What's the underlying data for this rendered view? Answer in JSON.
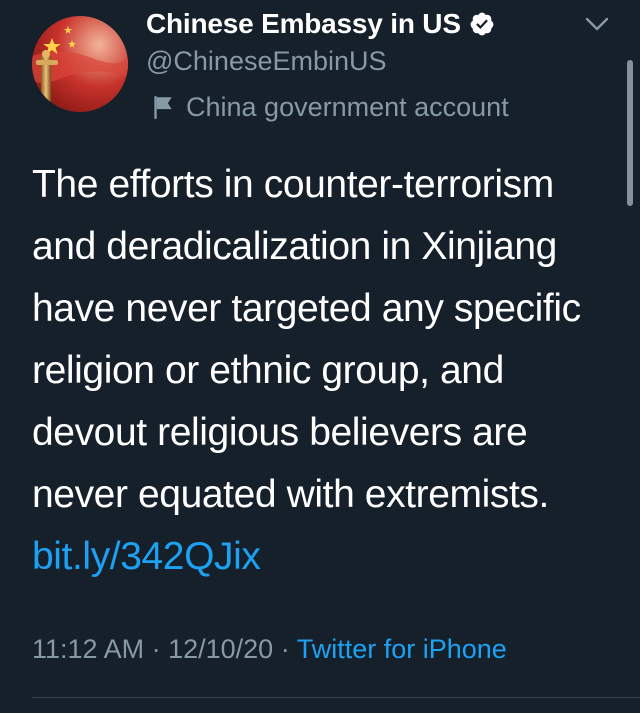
{
  "account": {
    "display_name": "Chinese Embassy in US",
    "handle": "@ChineseEmbinUS",
    "label": "China government account",
    "verified": true,
    "verified_icon": "verified-badge-icon",
    "label_icon": "flag-icon",
    "menu_icon": "chevron-down-icon"
  },
  "tweet": {
    "text": "The efforts in counter-terrorism and deradicalization in Xinjiang have never targeted any specific religion or ethnic group, and devout religious believers are never equated with extremists. ",
    "link": "bit.ly/342QJix"
  },
  "meta": {
    "time": "11:12 AM",
    "separator_1": " · ",
    "date": "12/10/20",
    "separator_2": " · ",
    "source": "Twitter for iPhone"
  },
  "colors": {
    "background": "#15202b",
    "text_primary": "#ffffff",
    "text_secondary": "#8899a6",
    "link": "#1da1f2",
    "divider": "#38444d"
  }
}
